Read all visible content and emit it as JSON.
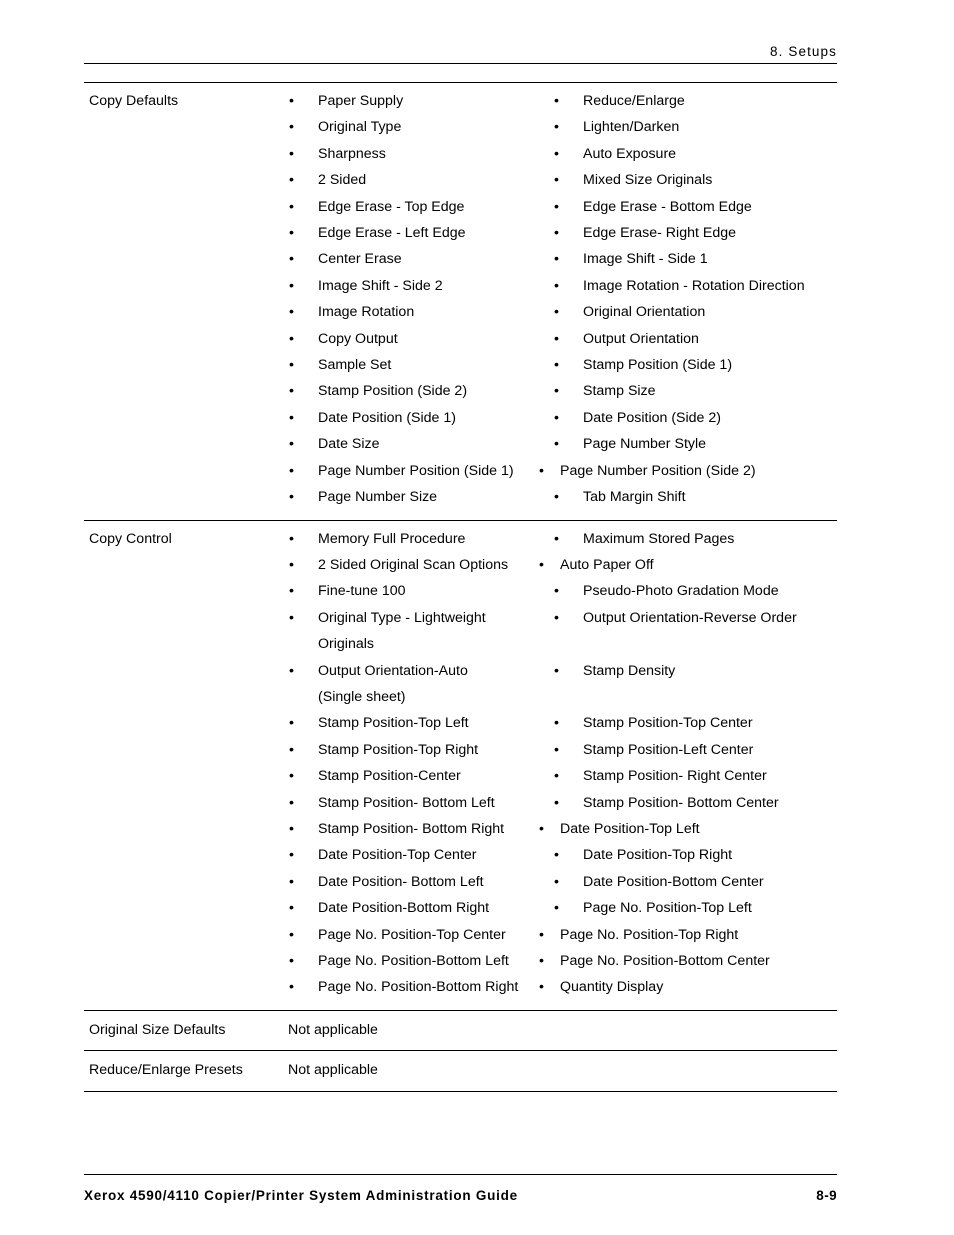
{
  "header": {
    "chapter_title": "8. Setups"
  },
  "footer": {
    "guide_title": "Xerox 4590/4110 Copier/Printer System Administration Guide",
    "page_number": "8-9"
  },
  "table": {
    "rows": [
      {
        "category": "Copy Defaults",
        "type": "pairs",
        "pairs": [
          {
            "left": "Paper Supply",
            "right": "Reduce/Enlarge"
          },
          {
            "left": "Original Type",
            "right": "Lighten/Darken"
          },
          {
            "left": "Sharpness",
            "right": "Auto Exposure"
          },
          {
            "left": "2 Sided",
            "right": "Mixed Size Originals"
          },
          {
            "left": "Edge Erase - Top Edge",
            "right": "Edge Erase - Bottom Edge"
          },
          {
            "left": "Edge Erase - Left Edge",
            "right": "Edge Erase- Right Edge"
          },
          {
            "left": "Center Erase",
            "right": "Image Shift - Side 1"
          },
          {
            "left": "Image Shift - Side 2",
            "right": "Image Rotation - Rotation Direction"
          },
          {
            "left": "Image Rotation",
            "right": "Original Orientation"
          },
          {
            "left": "Copy Output",
            "right": "Output Orientation"
          },
          {
            "left": "Sample Set",
            "right": "Stamp Position (Side 1)"
          },
          {
            "left": "Stamp Position (Side 2)",
            "right": "Stamp Size"
          },
          {
            "left": "Date Position (Side 1)",
            "right": "Date Position (Side 2)"
          },
          {
            "left": "Date Size",
            "right": "Page Number Style"
          },
          {
            "left": "Page Number Position (Side 1)",
            "right": "Page Number Position (Side 2)",
            "tight": true
          },
          {
            "left": "Page Number Size",
            "right": "Tab Margin Shift"
          }
        ]
      },
      {
        "category": "Copy Control",
        "type": "pairs",
        "pairs": [
          {
            "left": "Memory Full Procedure",
            "right": "Maximum Stored Pages"
          },
          {
            "left": "2 Sided Original Scan Options",
            "right": "Auto Paper Off",
            "tight": true
          },
          {
            "left": "Fine-tune 100",
            "right": "Pseudo-Photo Gradation Mode"
          },
          {
            "left": "Original Type - Lightweight\nOriginals",
            "right": "Output Orientation-Reverse Order"
          },
          {
            "left": "Output Orientation-Auto\n (Single sheet)",
            "right": "Stamp Density"
          },
          {
            "left": "Stamp Position-Top Left",
            "right": "Stamp Position-Top Center"
          },
          {
            "left": "Stamp Position-Top Right",
            "right": "Stamp Position-Left Center"
          },
          {
            "left": "Stamp Position-Center",
            "right": "Stamp Position- Right Center"
          },
          {
            "left": "Stamp Position- Bottom Left",
            "right": "Stamp Position- Bottom Center"
          },
          {
            "left": "Stamp Position- Bottom Right",
            "right": "Date Position-Top Left",
            "tight": true
          },
          {
            "left": "Date Position-Top Center",
            "right": "Date Position-Top Right"
          },
          {
            "left": "Date Position- Bottom Left",
            "right": "Date Position-Bottom Center"
          },
          {
            "left": "Date Position-Bottom Right",
            "right": "Page No. Position-Top Left"
          },
          {
            "left": "Page No. Position-Top Center",
            "right": "Page No. Position-Top Right",
            "tight": true
          },
          {
            "left": "Page No. Position-Bottom Left",
            "right": "Page No. Position-Bottom Center",
            "tight": true
          },
          {
            "left": "Page No. Position-Bottom Right",
            "right": "Quantity Display",
            "tight": true
          }
        ]
      },
      {
        "category": "Original Size Defaults",
        "type": "value",
        "value": "Not applicable"
      },
      {
        "category": "Reduce/Enlarge Presets",
        "type": "value",
        "value": "Not applicable"
      }
    ]
  },
  "bullet_glyph": "•"
}
